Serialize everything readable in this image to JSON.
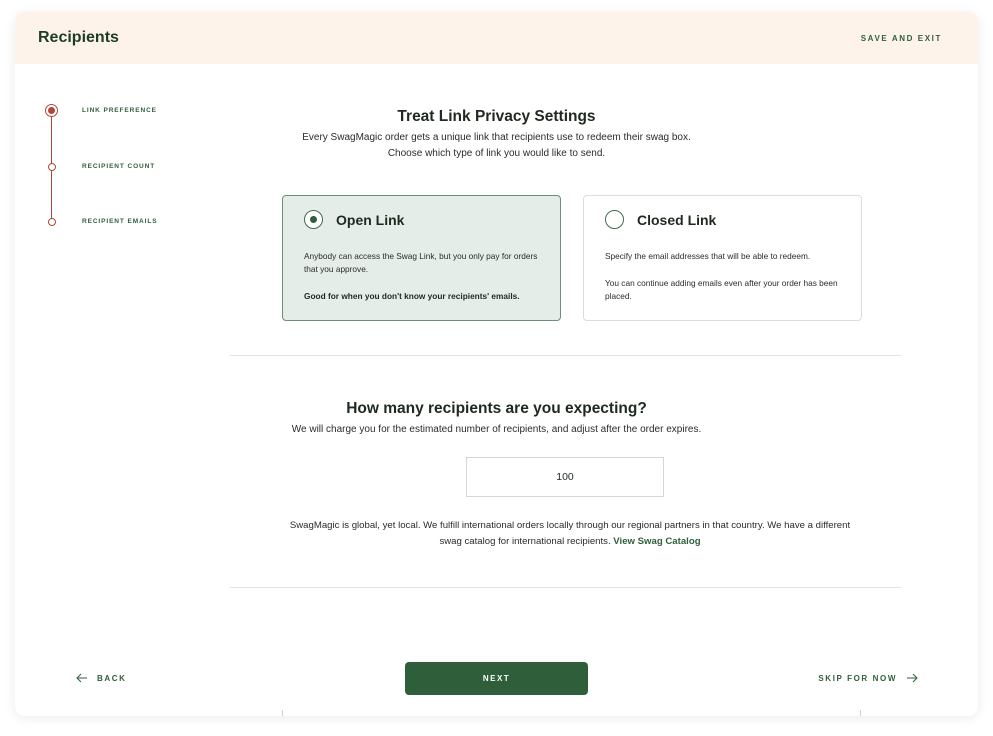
{
  "header": {
    "title": "Recipients",
    "save_label": "SAVE AND EXIT"
  },
  "stepper": {
    "steps": [
      {
        "label": "LINK PREFERENCE",
        "active": true
      },
      {
        "label": "RECIPIENT COUNT",
        "active": false
      },
      {
        "label": "RECIPIENT EMAILS",
        "active": false
      }
    ]
  },
  "privacy": {
    "title": "Treat Link Privacy Settings",
    "subtitle_line1": "Every SwagMagic order gets a unique link that recipients use to redeem their swag box.",
    "subtitle_line2": "Choose which type of link you would like to send.",
    "options": [
      {
        "title": "Open Link",
        "selected": true,
        "desc": "Anybody can access the Swag Link, but you only pay for orders that you approve.",
        "note": "Good for when you don't know your recipients' emails."
      },
      {
        "title": "Closed Link",
        "selected": false,
        "desc": "Specify the email addresses that will be able to redeem.",
        "note": "You can continue adding emails even after your order has been placed."
      }
    ]
  },
  "count": {
    "title": "How many recipients are you expecting?",
    "subtitle": "We will charge you for the estimated number of recipients, and adjust after the order expires.",
    "value": "100",
    "note": "SwagMagic is global, yet local. We fulfill international orders locally through our regional partners in that country. We have a different swag catalog for international recipients.",
    "link_label": "View Swag Catalog"
  },
  "footer": {
    "back_label": "BACK",
    "next_label": "NEXT",
    "skip_label": "SKIP FOR NOW"
  },
  "colors": {
    "accent": "#2f5f3a",
    "step": "#b0473c",
    "header_bg": "#fdf3ea",
    "selected_card": "#e4ede7"
  }
}
